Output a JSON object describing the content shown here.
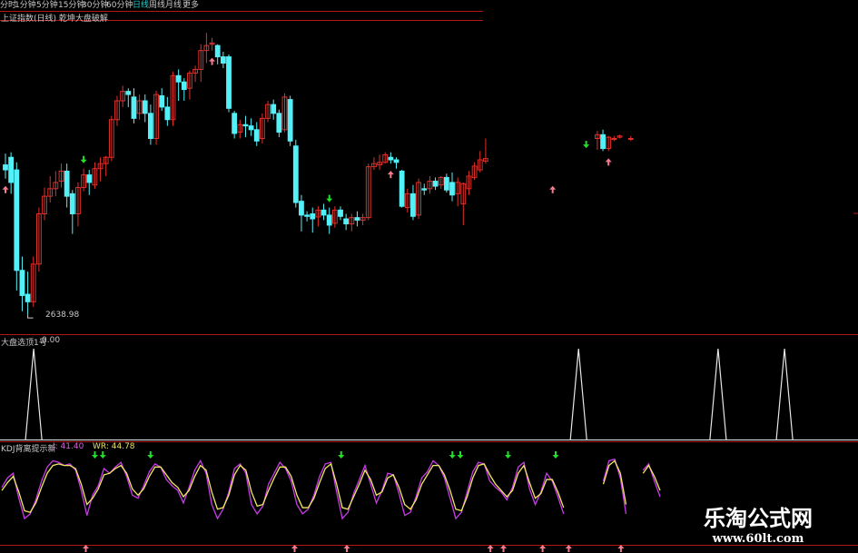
{
  "tabs": [
    {
      "label": "分时",
      "active": false
    },
    {
      "label": "1分钟",
      "active": false
    },
    {
      "label": "5分钟",
      "active": false
    },
    {
      "label": "15分钟",
      "active": false
    },
    {
      "label": "30分钟",
      "active": false
    },
    {
      "label": "60分钟",
      "active": false
    },
    {
      "label": "日线",
      "active": true
    },
    {
      "label": "周线",
      "active": false
    },
    {
      "label": "月线",
      "active": false
    },
    {
      "label": "更多",
      "active": false
    }
  ],
  "main_panel": {
    "title": "上证指数(日线) 乾坤大盘破解",
    "low_label": "2638.98"
  },
  "signal_panel": {
    "title": "大盘选顶1号",
    "value": "0.00"
  },
  "kdj_panel": {
    "title_prefix": "KDJ背离提示新",
    "j_label": "J: 41.40",
    "wr_label": "WR: 44.78"
  },
  "watermark": {
    "line1": "乐淘公式网",
    "line2": "www.60lt.com"
  },
  "colors": {
    "up": "#e0302a",
    "down": "#54f0f8",
    "grid": "#b01818",
    "signal_line": "#e8e8e8",
    "k_line": "#c83ce8",
    "d_line": "#f2e860",
    "green_arrow": "#22e028",
    "pink_arrow": "#f47a90"
  },
  "chart_data": {
    "type": "candlestick",
    "y_range": [
      2600,
      3080
    ],
    "candles": [
      [
        2858,
        2876,
        2836,
        2850
      ],
      [
        2870,
        2878,
        2812,
        2830
      ],
      [
        2850,
        2862,
        2658,
        2690
      ],
      [
        2690,
        2712,
        2625,
        2650
      ],
      [
        2652,
        2688,
        2620,
        2640
      ],
      [
        2640,
        2712,
        2632,
        2700
      ],
      [
        2700,
        2790,
        2688,
        2780
      ],
      [
        2780,
        2822,
        2770,
        2808
      ],
      [
        2808,
        2840,
        2798,
        2820
      ],
      [
        2820,
        2848,
        2808,
        2830
      ],
      [
        2832,
        2860,
        2822,
        2848
      ],
      [
        2848,
        2860,
        2790,
        2808
      ],
      [
        2812,
        2818,
        2748,
        2780
      ],
      [
        2780,
        2830,
        2760,
        2822
      ],
      [
        2822,
        2852,
        2816,
        2842
      ],
      [
        2842,
        2850,
        2810,
        2830
      ],
      [
        2826,
        2862,
        2820,
        2852
      ],
      [
        2852,
        2870,
        2832,
        2860
      ],
      [
        2860,
        2872,
        2840,
        2870
      ],
      [
        2870,
        2936,
        2864,
        2930
      ],
      [
        2930,
        2968,
        2920,
        2960
      ],
      [
        2960,
        2984,
        2950,
        2975
      ],
      [
        2975,
        2980,
        2950,
        2970
      ],
      [
        2966,
        2980,
        2924,
        2932
      ],
      [
        2940,
        2970,
        2930,
        2960
      ],
      [
        2960,
        2970,
        2926,
        2940
      ],
      [
        2940,
        2954,
        2890,
        2900
      ],
      [
        2900,
        2976,
        2890,
        2970
      ],
      [
        2968,
        2980,
        2944,
        2950
      ],
      [
        2950,
        2966,
        2920,
        2930
      ],
      [
        2930,
        3006,
        2920,
        3000
      ],
      [
        3000,
        3010,
        2960,
        2990
      ],
      [
        2990,
        2996,
        2960,
        2978
      ],
      [
        2980,
        3008,
        2962,
        3004
      ],
      [
        3004,
        3016,
        2990,
        3010
      ],
      [
        3010,
        3050,
        2990,
        3040
      ],
      [
        3040,
        3068,
        3020,
        3048
      ],
      [
        3050,
        3060,
        3040,
        3052
      ],
      [
        3048,
        3050,
        3018,
        3030
      ],
      [
        3030,
        3038,
        3012,
        3020
      ],
      [
        3030,
        3034,
        2942,
        2948
      ],
      [
        2940,
        2944,
        2900,
        2908
      ],
      [
        2910,
        2930,
        2900,
        2922
      ],
      [
        2922,
        2936,
        2902,
        2920
      ],
      [
        2920,
        2932,
        2904,
        2914
      ],
      [
        2914,
        2926,
        2888,
        2896
      ],
      [
        2900,
        2940,
        2892,
        2932
      ],
      [
        2932,
        2960,
        2926,
        2954
      ],
      [
        2954,
        2962,
        2930,
        2940
      ],
      [
        2940,
        2946,
        2902,
        2910
      ],
      [
        2914,
        2972,
        2910,
        2966
      ],
      [
        2962,
        2968,
        2888,
        2896
      ],
      [
        2888,
        2898,
        2790,
        2798
      ],
      [
        2800,
        2810,
        2752,
        2778
      ],
      [
        2778,
        2784,
        2768,
        2776
      ],
      [
        2780,
        2790,
        2750,
        2772
      ],
      [
        2775,
        2792,
        2760,
        2786
      ],
      [
        2786,
        2796,
        2770,
        2778
      ],
      [
        2778,
        2790,
        2748,
        2762
      ],
      [
        2765,
        2792,
        2758,
        2786
      ],
      [
        2786,
        2792,
        2770,
        2776
      ],
      [
        2772,
        2780,
        2754,
        2764
      ],
      [
        2764,
        2780,
        2752,
        2774
      ],
      [
        2774,
        2784,
        2760,
        2770
      ],
      [
        2770,
        2780,
        2762,
        2774
      ],
      [
        2774,
        2860,
        2770,
        2855
      ],
      [
        2855,
        2870,
        2850,
        2860
      ],
      [
        2858,
        2874,
        2850,
        2862
      ],
      [
        2862,
        2878,
        2860,
        2874
      ],
      [
        2870,
        2878,
        2860,
        2866
      ],
      [
        2866,
        2870,
        2852,
        2862
      ],
      [
        2848,
        2850,
        2790,
        2792
      ],
      [
        2790,
        2820,
        2782,
        2812
      ],
      [
        2812,
        2826,
        2770,
        2776
      ],
      [
        2778,
        2836,
        2772,
        2830
      ],
      [
        2820,
        2828,
        2810,
        2818
      ],
      [
        2820,
        2840,
        2812,
        2832
      ],
      [
        2832,
        2838,
        2818,
        2824
      ],
      [
        2826,
        2840,
        2820,
        2838
      ],
      [
        2838,
        2844,
        2814,
        2818
      ],
      [
        2830,
        2846,
        2800,
        2810
      ],
      [
        2812,
        2838,
        2792,
        2830
      ],
      [
        2796,
        2830,
        2762,
        2828
      ],
      [
        2820,
        2848,
        2810,
        2840
      ],
      [
        2838,
        2862,
        2834,
        2856
      ],
      [
        2850,
        2880,
        2846,
        2866
      ],
      [
        2864,
        2900,
        2860,
        2868
      ],
      null,
      null,
      null,
      null,
      null,
      null,
      null,
      null,
      null,
      null,
      null,
      null,
      null,
      null,
      null,
      null,
      null,
      null,
      null,
      [
        2900,
        2912,
        2882,
        2906
      ],
      [
        2906,
        2914,
        2880,
        2884
      ],
      [
        2884,
        2904,
        2880,
        2902
      ],
      [
        2900,
        2904,
        2896,
        2900
      ],
      [
        2902,
        2906,
        2900,
        2904
      ],
      null,
      [
        2900,
        2904,
        2896,
        2900
      ]
    ],
    "signal_spikes": [
      3,
      85,
      106,
      116
    ],
    "k_values": [
      62,
      74,
      80,
      48,
      22,
      28,
      46,
      70,
      88,
      96,
      94,
      90,
      92,
      84,
      58,
      26,
      52,
      64,
      86,
      80,
      88,
      94,
      76,
      52,
      48,
      64,
      82,
      92,
      88,
      72,
      64,
      58,
      42,
      62,
      84,
      96,
      80,
      40,
      22,
      34,
      56,
      86,
      92,
      80,
      40,
      28,
      38,
      66,
      80,
      94,
      86,
      70,
      40,
      28,
      34,
      52,
      76,
      92,
      94,
      56,
      22,
      30,
      54,
      72,
      90,
      66,
      42,
      58,
      80,
      78,
      54,
      26,
      30,
      50,
      74,
      82,
      96,
      90,
      74,
      48,
      22,
      30,
      56,
      82,
      94,
      92,
      70,
      62,
      56,
      46,
      62,
      88,
      94,
      60,
      40,
      56,
      80,
      70,
      50,
      28,
      null,
      null,
      null,
      null,
      null,
      null,
      70,
      96,
      98,
      74,
      28,
      null,
      null,
      84,
      92,
      70,
      50,
      null,
      null,
      null,
      null
    ],
    "d_values": [
      58,
      68,
      76,
      56,
      32,
      30,
      42,
      62,
      80,
      90,
      92,
      90,
      90,
      86,
      66,
      40,
      48,
      60,
      78,
      80,
      86,
      90,
      80,
      60,
      52,
      60,
      76,
      88,
      88,
      78,
      68,
      62,
      50,
      58,
      76,
      90,
      84,
      56,
      34,
      36,
      52,
      78,
      90,
      84,
      56,
      38,
      40,
      58,
      74,
      88,
      88,
      76,
      52,
      36,
      36,
      48,
      68,
      86,
      92,
      66,
      36,
      34,
      50,
      66,
      84,
      72,
      52,
      56,
      74,
      78,
      62,
      40,
      34,
      46,
      66,
      78,
      90,
      90,
      78,
      58,
      34,
      32,
      50,
      74,
      90,
      92,
      78,
      66,
      58,
      50,
      58,
      80,
      90,
      68,
      48,
      54,
      72,
      72,
      56,
      36,
      null,
      null,
      null,
      null,
      null,
      null,
      66,
      90,
      96,
      80,
      40,
      null,
      null,
      80,
      90,
      76,
      58,
      null,
      null,
      null,
      null
    ],
    "green_arrows": [
      14,
      58,
      104
    ],
    "pink_arrows": [
      0,
      37,
      69,
      98,
      108
    ],
    "kdj_green_arrows": [
      6,
      7,
      13,
      37,
      51,
      52,
      58,
      64
    ],
    "kdj_pink_arrows": [
      4,
      20,
      24,
      35,
      36,
      39,
      41,
      45,
      75,
      76
    ]
  }
}
